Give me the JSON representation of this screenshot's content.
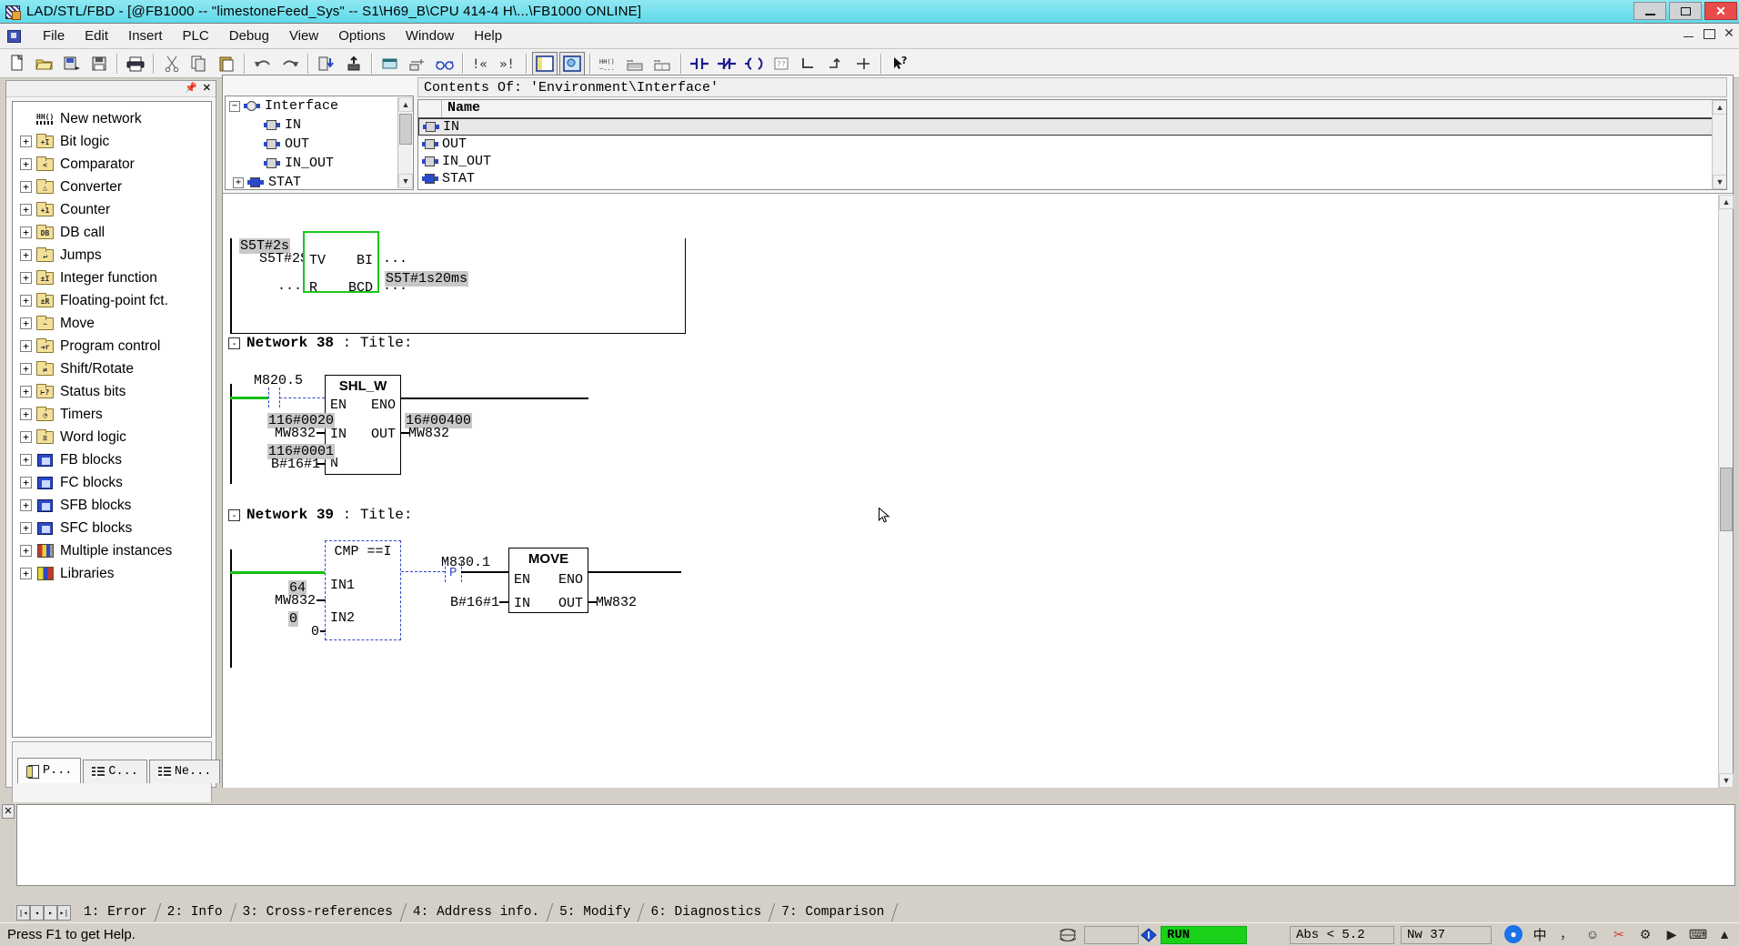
{
  "window": {
    "title": "LAD/STL/FBD  - [@FB1000 -- \"limestoneFeed_Sys\" -- S1\\H69_B\\CPU 414-4 H\\...\\FB1000  ONLINE]",
    "icon": "lad-stl-fbd-icon",
    "minimize": "minimize-button",
    "maximize": "maximize-button",
    "close": "close-button"
  },
  "menu": {
    "items": [
      "File",
      "Edit",
      "Insert",
      "PLC",
      "Debug",
      "View",
      "Options",
      "Window",
      "Help"
    ]
  },
  "toolbar": {
    "buttons": [
      "new-document-icon",
      "open-folder-icon",
      "save-as-icon",
      "save-icon",
      "print-icon",
      "cut-icon",
      "copy-icon",
      "paste-icon",
      "undo-icon",
      "redo-icon",
      "download-to-plc-icon",
      "upload-icon",
      "insert-network-icon",
      "display-with-icon",
      "monitor-glasses-icon",
      "prev-error-icon",
      "next-error-icon",
      "overview-panel-icon",
      "details-panel-icon",
      "symbol-info-icon",
      "symbol-table-icon",
      "symbol-select-icon",
      "no-contact-icon",
      "nc-contact-icon",
      "coil-icon",
      "empty-box-icon",
      "branch-open-icon",
      "branch-close-icon",
      "branch-end-icon",
      "help-pointer-icon"
    ]
  },
  "left_panel": {
    "pin": "pin-icon",
    "close": "close-icon",
    "tree": [
      {
        "label": "New network",
        "expandable": false,
        "icon": "new-network-icon"
      },
      {
        "label": "Bit logic",
        "expandable": true,
        "icon": "folder-icon",
        "glyph": "+I"
      },
      {
        "label": "Comparator",
        "expandable": true,
        "icon": "folder-icon",
        "glyph": "<"
      },
      {
        "label": "Converter",
        "expandable": true,
        "icon": "folder-icon",
        "glyph": "△"
      },
      {
        "label": "Counter",
        "expandable": true,
        "icon": "folder-icon",
        "glyph": "+1"
      },
      {
        "label": "DB call",
        "expandable": true,
        "icon": "folder-icon",
        "glyph": "DB"
      },
      {
        "label": "Jumps",
        "expandable": true,
        "icon": "folder-icon",
        "glyph": "↵"
      },
      {
        "label": "Integer function",
        "expandable": true,
        "icon": "folder-icon",
        "glyph": "±I"
      },
      {
        "label": "Floating-point fct.",
        "expandable": true,
        "icon": "folder-icon",
        "glyph": "±R"
      },
      {
        "label": "Move",
        "expandable": true,
        "icon": "folder-icon",
        "glyph": "~"
      },
      {
        "label": "Program control",
        "expandable": true,
        "icon": "folder-icon",
        "glyph": "⇥r"
      },
      {
        "label": "Shift/Rotate",
        "expandable": true,
        "icon": "folder-icon",
        "glyph": "⇄"
      },
      {
        "label": "Status bits",
        "expandable": true,
        "icon": "folder-icon",
        "glyph": "⊢?"
      },
      {
        "label": "Timers",
        "expandable": true,
        "icon": "folder-icon",
        "glyph": "◔"
      },
      {
        "label": "Word logic",
        "expandable": true,
        "icon": "folder-icon",
        "glyph": "≡"
      },
      {
        "label": "FB blocks",
        "expandable": true,
        "icon": "fb-block-icon"
      },
      {
        "label": "FC blocks",
        "expandable": true,
        "icon": "fc-block-icon"
      },
      {
        "label": "SFB blocks",
        "expandable": true,
        "icon": "sfb-block-icon"
      },
      {
        "label": "SFC blocks",
        "expandable": true,
        "icon": "sfc-block-icon"
      },
      {
        "label": "Multiple instances",
        "expandable": true,
        "icon": "multiple-instances-icon"
      },
      {
        "label": "Libraries",
        "expandable": true,
        "icon": "libraries-icon"
      }
    ],
    "resize_icon": "resize-grip-icon",
    "tabs": [
      {
        "label": "P...",
        "icon": "program-elements-icon",
        "active": true
      },
      {
        "label": "C...",
        "icon": "call-structure-icon",
        "active": false
      },
      {
        "label": "Ne...",
        "icon": "network-list-icon",
        "active": false
      }
    ]
  },
  "interface_pane": {
    "contents_of": "Contents Of: 'Environment\\Interface'",
    "tree": [
      {
        "label": "Interface",
        "expander": "-",
        "icon": "interface-root-icon",
        "indent": 0
      },
      {
        "label": "IN",
        "expander": "",
        "icon": "var-in-icon",
        "indent": 1
      },
      {
        "label": "OUT",
        "expander": "",
        "icon": "var-out-icon",
        "indent": 1
      },
      {
        "label": "IN_OUT",
        "expander": "",
        "icon": "var-inout-icon",
        "indent": 1
      },
      {
        "label": "STAT",
        "expander": "+",
        "icon": "var-stat-icon",
        "indent": 1
      }
    ],
    "list": {
      "column_header": "Name",
      "rows": [
        {
          "name": "IN",
          "icon": "var-in-icon",
          "selected": true
        },
        {
          "name": "OUT",
          "icon": "var-out-icon",
          "selected": false
        },
        {
          "name": "IN_OUT",
          "icon": "var-inout-icon",
          "selected": false
        },
        {
          "name": "STAT",
          "icon": "var-stat-icon",
          "selected": false
        }
      ]
    }
  },
  "ladder": {
    "network_37_partial": {
      "timer_status": "S5T#2s",
      "tv_label": "S5T#2S",
      "tv_pin": "TV",
      "bi_pin": "BI",
      "bi_value": "...",
      "bcd_status": "S5T#1s20ms",
      "r_label": "...",
      "r_pin": "R",
      "bcd_pin": "BCD",
      "bcd_value": "..."
    },
    "networks": [
      {
        "collapse": "-",
        "title": "Network 38 : Title:",
        "title_bold": "Network 38",
        "title_rest": ": Title:",
        "contact_label": "M820.5",
        "block_name": "SHL_W",
        "pins": {
          "en": "EN",
          "eno": "ENO",
          "in": "IN",
          "out": "OUT",
          "n": "N"
        },
        "in_status": "116#0020",
        "in_operand": "MW832",
        "n_status": "116#0001",
        "n_operand": "B#16#1",
        "out_status": "16#00400",
        "out_operand": "MW832"
      },
      {
        "collapse": "-",
        "title": "Network 39 : Title:",
        "title_bold": "Network 39",
        "title_rest": ": Title:",
        "cmp_name": "CMP ==I",
        "in1_status": "64",
        "in1_operand": "MW832",
        "in1_pin": "IN1",
        "in2_status": "0",
        "in2_operand": "0",
        "in2_pin": "IN2",
        "p_coil_label": "M830.1",
        "p_coil": "P",
        "move_name": "MOVE",
        "move_pins": {
          "en": "EN",
          "eno": "ENO",
          "in": "IN",
          "out": "OUT"
        },
        "move_in_operand": "B#16#1",
        "move_out_operand": "MW832"
      }
    ]
  },
  "output_window": {
    "close": "close-icon",
    "nav": [
      "first-record-icon",
      "prev-record-icon",
      "next-record-icon",
      "last-record-icon"
    ],
    "tabs": [
      "1: Error",
      "2: Info",
      "3: Cross-references",
      "4: Address info.",
      "5: Modify",
      "6: Diagnostics",
      "7: Comparison"
    ]
  },
  "statusbar": {
    "hint": "Press F1 to get Help.",
    "network_icon": "network-status-icon",
    "empty_cell": "",
    "mode_icon": "plc-mode-icon",
    "mode": "RUN",
    "absolute": "Abs < 5.2",
    "network": "Nw 37",
    "tray": [
      {
        "name": "search-icon",
        "glyph": "●"
      },
      {
        "name": "ime-chinese-icon",
        "glyph": "中"
      },
      {
        "name": "ime-punctuation-icon",
        "glyph": "，"
      },
      {
        "name": "emoji-icon",
        "glyph": "☺"
      },
      {
        "name": "ime-toolbox-icon",
        "glyph": "✂"
      },
      {
        "name": "ime-settings-icon",
        "glyph": "⚙"
      },
      {
        "name": "speaker-icon",
        "glyph": "▶"
      },
      {
        "name": "keyboard-icon",
        "glyph": "⌨"
      },
      {
        "name": "tray-expand-icon",
        "glyph": "▲"
      }
    ]
  },
  "colors": {
    "title_bg": "#5fd9ea",
    "green_wire": "#15c115",
    "blue_select": "#3344cc",
    "run_green": "#19d119",
    "status_highlight": "#c8c8c8"
  }
}
